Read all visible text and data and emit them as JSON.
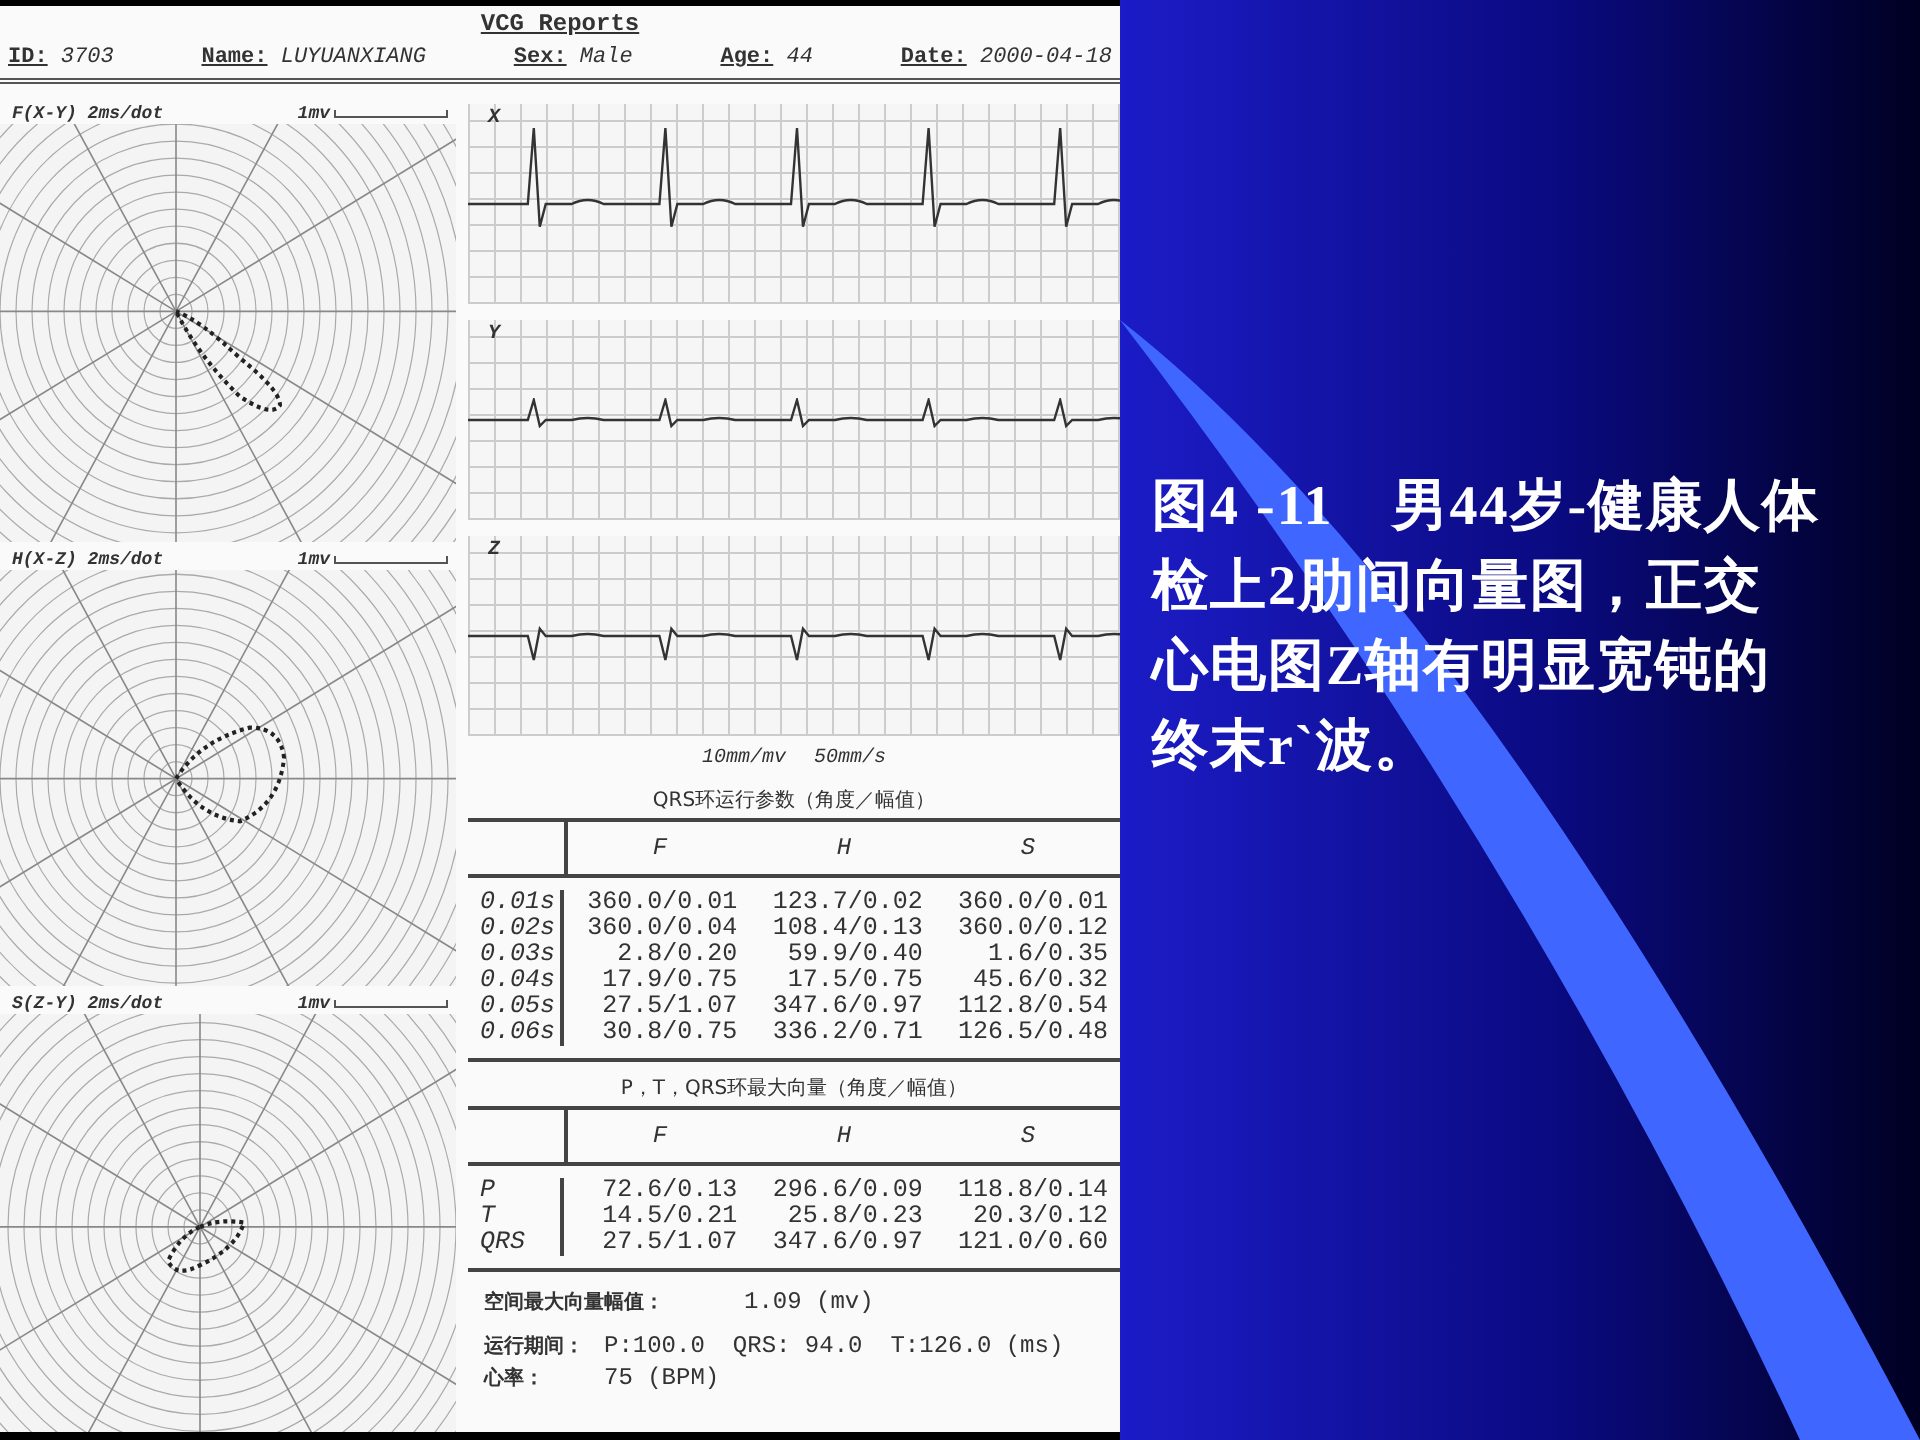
{
  "report": {
    "title": "VCG Reports",
    "fields": [
      {
        "label": "ID:",
        "value": "3703"
      },
      {
        "label": "Name:",
        "value": "LUYUANXIANG"
      },
      {
        "label": "Sex:",
        "value": "Male"
      },
      {
        "label": "Age:",
        "value": "44"
      },
      {
        "label": "Date:",
        "value": "2000-04-18"
      }
    ],
    "loops": [
      {
        "label": "F(X-Y) 2ms/dot",
        "scale": "1mv"
      },
      {
        "label": "H(X-Z) 2ms/dot",
        "scale": "1mv"
      },
      {
        "label": "S(Z-Y) 2ms/dot",
        "scale": "1mv"
      }
    ],
    "leads": [
      {
        "label": "X"
      },
      {
        "label": "Y"
      },
      {
        "label": "Z"
      }
    ],
    "speed": [
      "10mm/mv",
      "50mm/s"
    ],
    "tables": [
      {
        "title": "QRS环运行参数（角度／幅值）",
        "columns": [
          "F",
          "H",
          "S"
        ],
        "rows": [
          {
            "label": "0.01s",
            "cells": [
              "360.0/0.01",
              "123.7/0.02",
              "360.0/0.01"
            ]
          },
          {
            "label": "0.02s",
            "cells": [
              "360.0/0.04",
              "108.4/0.13",
              "360.0/0.12"
            ]
          },
          {
            "label": "0.03s",
            "cells": [
              "2.8/0.20",
              "59.9/0.40",
              "1.6/0.35"
            ]
          },
          {
            "label": "0.04s",
            "cells": [
              "17.9/0.75",
              "17.5/0.75",
              "45.6/0.32"
            ]
          },
          {
            "label": "0.05s",
            "cells": [
              "27.5/1.07",
              "347.6/0.97",
              "112.8/0.54"
            ]
          },
          {
            "label": "0.06s",
            "cells": [
              "30.8/0.75",
              "336.2/0.71",
              "126.5/0.48"
            ]
          }
        ]
      },
      {
        "title": "P，T，QRS环最大向量（角度／幅值）",
        "columns": [
          "F",
          "H",
          "S"
        ],
        "rows": [
          {
            "label": "P",
            "cells": [
              "72.6/0.13",
              "296.6/0.09",
              "118.8/0.14"
            ]
          },
          {
            "label": "T",
            "cells": [
              "14.5/0.21",
              "25.8/0.23",
              "20.3/0.12"
            ]
          },
          {
            "label": "QRS",
            "cells": [
              "27.5/1.07",
              "347.6/0.97",
              "121.0/0.60"
            ]
          }
        ]
      }
    ],
    "spatial_max": {
      "label": "空间最大向量幅值：",
      "value": "1.09 (mv)"
    },
    "durations": {
      "label": "运行期间：",
      "values": [
        "P:100.0",
        "QRS: 94.0",
        "T:126.0 (ms)"
      ]
    },
    "heart_rate": {
      "label": "心率：",
      "value": "75 (BPM)"
    }
  },
  "caption": [
    "图4 -11　男44岁-健康人体",
    "检上2肋间向量图，正交",
    "心电图Z轴有明显宽钝的",
    "终末r`波。"
  ]
}
